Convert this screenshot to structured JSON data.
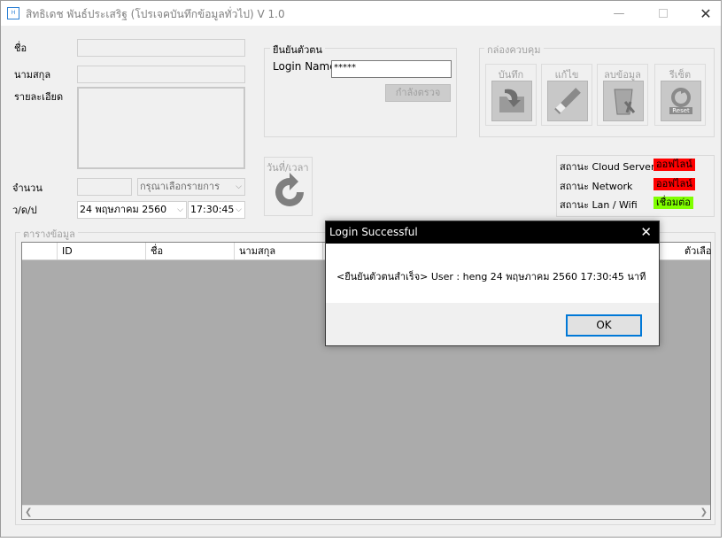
{
  "window": {
    "icon_text": "H",
    "title": "สิทธิเดช พันธ์ประเสริฐ (โปรเจคบันทึกข้อมูลทั่วไป) V 1.0"
  },
  "form": {
    "name_label": "ชื่อ",
    "surname_label": "นามสกุล",
    "detail_label": "รายละเอียด",
    "amount_label": "จำนวน",
    "item_select_value": "กรุณาเลือกรายการ",
    "date_label": "ว/ด/ป",
    "date_value": "24  พฤษภาคม    2560",
    "time_value": "17:30:45"
  },
  "login": {
    "group_title": "ยืนยันตัวตน",
    "name_label": "Login Name",
    "password_value": "*****",
    "check_button": "กำลังตรวจ"
  },
  "control": {
    "group_title": "กล่องควบคุม",
    "buttons": [
      "บันทึก",
      "แก้ไข",
      "ลบข้อมูล",
      "รีเซ็ต"
    ],
    "reset_icon_text": "Reset"
  },
  "datetime_box": {
    "caption": "วันที่/เวลา"
  },
  "status": {
    "cloud_label": "สถานะ Cloud Server",
    "cloud_value": "ออฟไลน์",
    "network_label": "สถานะ Network",
    "network_value": "ออฟไลน์",
    "lan_label": "สถานะ Lan / Wifi",
    "lan_value": "เชื่อมต่อ",
    "colors": {
      "offline": "#ff0000",
      "online": "#80ff00"
    }
  },
  "table": {
    "group_title": "ตารางข้อมูล",
    "columns": [
      "ID",
      "ชื่อ",
      "นามสกุล",
      "ตัวเลือ"
    ]
  },
  "dialog": {
    "title": "Login Successful",
    "message": "<ยืนยันตัวตนสำเร็จ>  User : heng   24 พฤษภาคม 2560   17:30:45 นาที",
    "ok_label": "OK"
  }
}
